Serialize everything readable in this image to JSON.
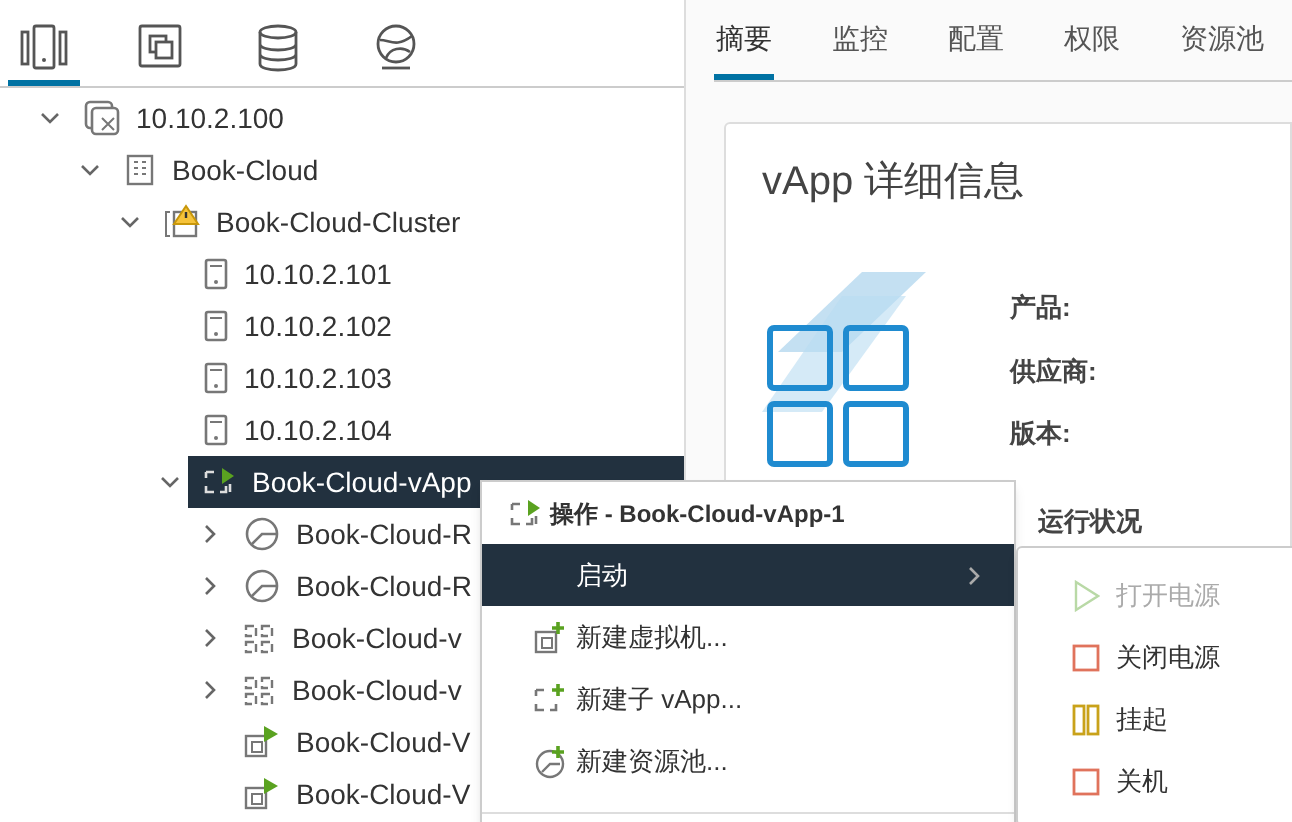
{
  "nav_tabs": [
    {
      "kind": "hosts",
      "selected": true
    },
    {
      "kind": "vms",
      "selected": false
    },
    {
      "kind": "storage",
      "selected": false
    },
    {
      "kind": "network",
      "selected": false
    }
  ],
  "tree": [
    {
      "label": "10.10.2.100",
      "kind": "vcenter",
      "expanded": true,
      "selected": false,
      "children": [
        {
          "label": "Book-Cloud",
          "kind": "datacenter",
          "expanded": true,
          "selected": false,
          "children": [
            {
              "label": "Book-Cloud-Cluster",
              "kind": "cluster",
              "expanded": true,
              "selected": false,
              "children": [
                {
                  "label": "10.10.2.101",
                  "kind": "host",
                  "selected": false
                },
                {
                  "label": "10.10.2.102",
                  "kind": "host",
                  "selected": false
                },
                {
                  "label": "10.10.2.103",
                  "kind": "host",
                  "selected": false
                },
                {
                  "label": "10.10.2.104",
                  "kind": "host",
                  "selected": false
                },
                {
                  "label": "Book-Cloud-vApp",
                  "kind": "vapp-on",
                  "expanded": true,
                  "selected": true,
                  "children": [
                    {
                      "label": "Book-Cloud-R",
                      "kind": "pool",
                      "expanded": false,
                      "selected": false
                    },
                    {
                      "label": "Book-Cloud-R",
                      "kind": "pool",
                      "expanded": false,
                      "selected": false
                    },
                    {
                      "label": "Book-Cloud-v",
                      "kind": "vapp",
                      "expanded": false,
                      "selected": false
                    },
                    {
                      "label": "Book-Cloud-v",
                      "kind": "vapp",
                      "expanded": false,
                      "selected": false
                    },
                    {
                      "label": "Book-Cloud-V",
                      "kind": "vm"
                    },
                    {
                      "label": "Book-Cloud-V",
                      "kind": "vm"
                    }
                  ]
                }
              ]
            }
          ]
        }
      ]
    }
  ],
  "tabs": [
    {
      "label": "摘要",
      "selected": true
    },
    {
      "label": "监控",
      "selected": false
    },
    {
      "label": "配置",
      "selected": false
    },
    {
      "label": "权限",
      "selected": false
    },
    {
      "label": "资源池",
      "selected": false
    }
  ],
  "card": {
    "title": "vApp 详细信息",
    "fields": [
      "产品:",
      "供应商:",
      "版本:"
    ],
    "section": "运行状况"
  },
  "context_menu": {
    "title": "操作 - Book-Cloud-vApp-1",
    "items": [
      {
        "label": "启动",
        "kind": "submenu",
        "selected": true
      },
      {
        "label": "新建虚拟机...",
        "kind": "new-vm",
        "selected": false
      },
      {
        "label": "新建子 vApp...",
        "kind": "new-vapp",
        "selected": false
      },
      {
        "label": "新建资源池...",
        "kind": "new-pool",
        "selected": false
      }
    ]
  },
  "submenu": [
    {
      "label": "打开电源",
      "kind": "play",
      "disabled": true
    },
    {
      "label": "关闭电源",
      "kind": "stop",
      "disabled": false
    },
    {
      "label": "挂起",
      "kind": "pause",
      "disabled": false
    },
    {
      "label": "关机",
      "kind": "stop",
      "disabled": false
    }
  ]
}
